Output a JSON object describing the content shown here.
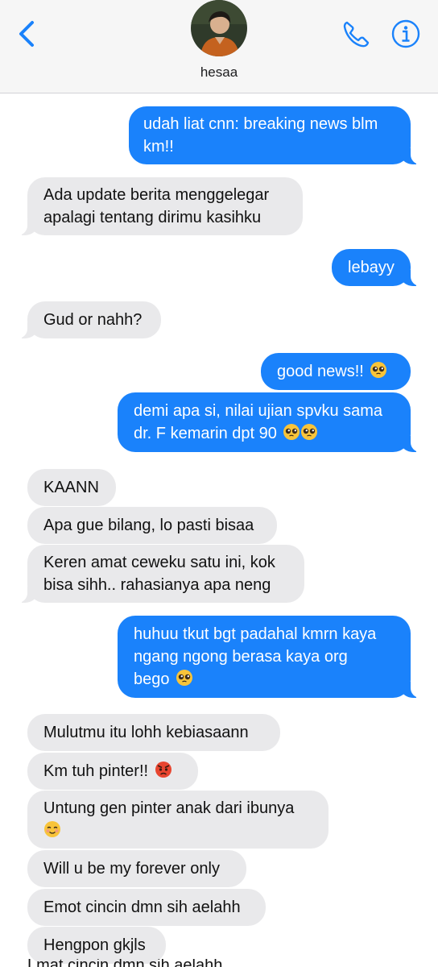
{
  "header": {
    "contact_name": "hesaa",
    "colors": {
      "accent": "#1a82fb",
      "outgoing": "#1a82fb",
      "incoming": "#e9e9eb"
    },
    "icons": [
      "chevron-left-icon",
      "phone-icon",
      "info-icon"
    ]
  },
  "messages": [
    {
      "dir": "out",
      "text": "udah liat cnn: breaking news blm",
      "text2": "km!!"
    },
    {
      "dir": "in",
      "text": "Ada update berita menggelegar",
      "text2": "apalagi tentang dirimu kasihku"
    },
    {
      "dir": "out",
      "text": "lebayy"
    },
    {
      "dir": "in",
      "text": "Gud or nahh?"
    },
    {
      "dir": "out",
      "text": "good news!!",
      "emoji": "pleading-face"
    },
    {
      "dir": "out",
      "text": "demi apa si, nilai ujian spvku sama",
      "text2": "dr. F kemarin dpt 90",
      "emoji": "pleading-face x2"
    },
    {
      "dir": "in",
      "text": "KAANN"
    },
    {
      "dir": "in",
      "text": "Apa gue bilang, lo pasti bisaa"
    },
    {
      "dir": "in",
      "text": "Keren amat ceweku satu ini, kok",
      "text2": "bisa sihh.. rahasianya apa neng"
    },
    {
      "dir": "out",
      "text": "huhuu tkut bgt padahal kmrn kaya",
      "text2": "ngang ngong berasa kaya org",
      "text3": "bego",
      "emoji": "pleading-face"
    },
    {
      "dir": "in",
      "text": "Mulutmu itu lohh kebiasaann"
    },
    {
      "dir": "in",
      "text": "Km tuh pinter!!",
      "emoji": "angry-face"
    },
    {
      "dir": "in",
      "text": "Untung gen pinter anak dari ibunya",
      "emoji": "smiling-face"
    },
    {
      "dir": "in",
      "text": "Will u be my forever only"
    },
    {
      "dir": "in",
      "text": "Emot cincin dmn sih aelahh"
    },
    {
      "dir": "in",
      "text": "Hengpon gkjls"
    }
  ],
  "cut_text": "Lmat cincin dmn sih aelahh"
}
